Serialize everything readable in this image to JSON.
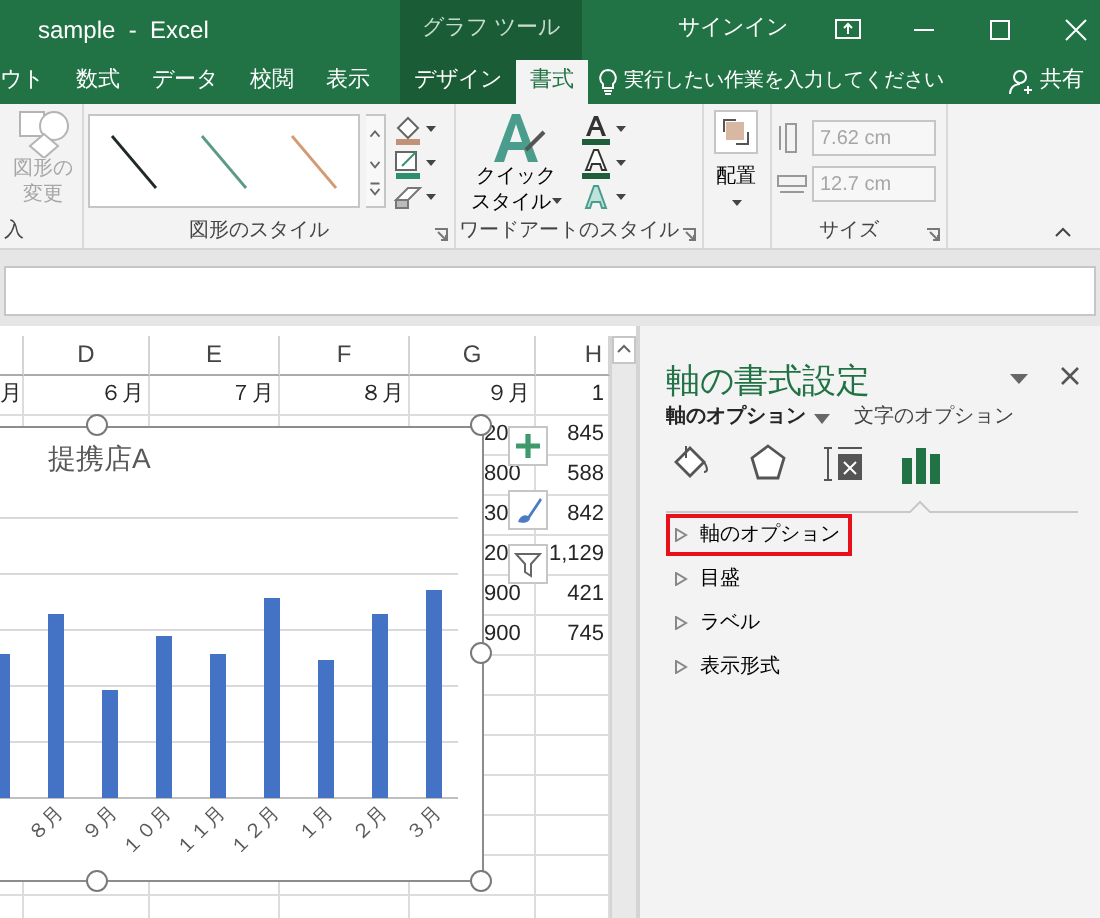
{
  "window": {
    "title": "sample  -  Excel",
    "tool_group": "グラフ ツール",
    "sign_in": "サインイン"
  },
  "tabs": [
    {
      "label": "ウト",
      "selected": false,
      "contextual": false
    },
    {
      "label": "数式",
      "selected": false,
      "contextual": false
    },
    {
      "label": "データ",
      "selected": false,
      "contextual": false
    },
    {
      "label": "校閲",
      "selected": false,
      "contextual": false
    },
    {
      "label": "表示",
      "selected": false,
      "contextual": false
    },
    {
      "label": "デザイン",
      "selected": false,
      "contextual": true
    },
    {
      "label": "書式",
      "selected": true,
      "contextual": true
    }
  ],
  "tell_me": {
    "placeholder": "実行したい作業を入力してください"
  },
  "share": {
    "label": "共有"
  },
  "ribbon": {
    "insert_group": {
      "label": "入"
    },
    "change_shape": {
      "label": "図形の変更",
      "disabled": true
    },
    "shape_styles": {
      "label": "図形のスタイル"
    },
    "quick_style": {
      "label": "クイックスタイル"
    },
    "wordart": {
      "label": "ワードアートのスタイル"
    },
    "arrange": {
      "label": "配置"
    },
    "size": {
      "label": "サイズ",
      "height": "7.62 cm",
      "width": "12.7 cm",
      "disabled": true
    }
  },
  "sheet": {
    "columns": [
      null,
      "D",
      "E",
      "F",
      "G",
      "H"
    ],
    "rows": [
      [
        "月",
        "６月",
        "７月",
        "８月",
        "９月",
        "1"
      ],
      [
        null,
        null,
        null,
        null,
        "20",
        "845"
      ],
      [
        null,
        null,
        null,
        null,
        "800",
        "588"
      ],
      [
        null,
        null,
        null,
        null,
        "30",
        "842"
      ],
      [
        null,
        null,
        null,
        null,
        "20",
        "1,129"
      ],
      [
        null,
        null,
        null,
        null,
        "900",
        "421"
      ],
      [
        null,
        null,
        null,
        null,
        "900",
        "745"
      ]
    ]
  },
  "chart": {
    "title": "提携店A",
    "selected": true,
    "categories": [
      "８月",
      "９月",
      "１０月",
      "１１月",
      "１２月",
      "１月",
      "２月",
      "３月"
    ]
  },
  "format_pane": {
    "title": "軸の書式設定",
    "tabs": [
      {
        "label": "軸のオプション",
        "selected": true
      },
      {
        "label": "文字のオプション",
        "selected": false
      }
    ],
    "icon_tabs": [
      {
        "kind": "fill",
        "selected": false
      },
      {
        "kind": "effects",
        "selected": false
      },
      {
        "kind": "size",
        "selected": false
      },
      {
        "kind": "axis",
        "selected": true
      }
    ],
    "sections": [
      {
        "label": "軸のオプション",
        "expanded": false,
        "highlighted": true
      },
      {
        "label": "目盛",
        "expanded": false,
        "highlighted": false
      },
      {
        "label": "ラベル",
        "expanded": false,
        "highlighted": false
      },
      {
        "label": "表示形式",
        "expanded": false,
        "highlighted": false
      }
    ]
  }
}
